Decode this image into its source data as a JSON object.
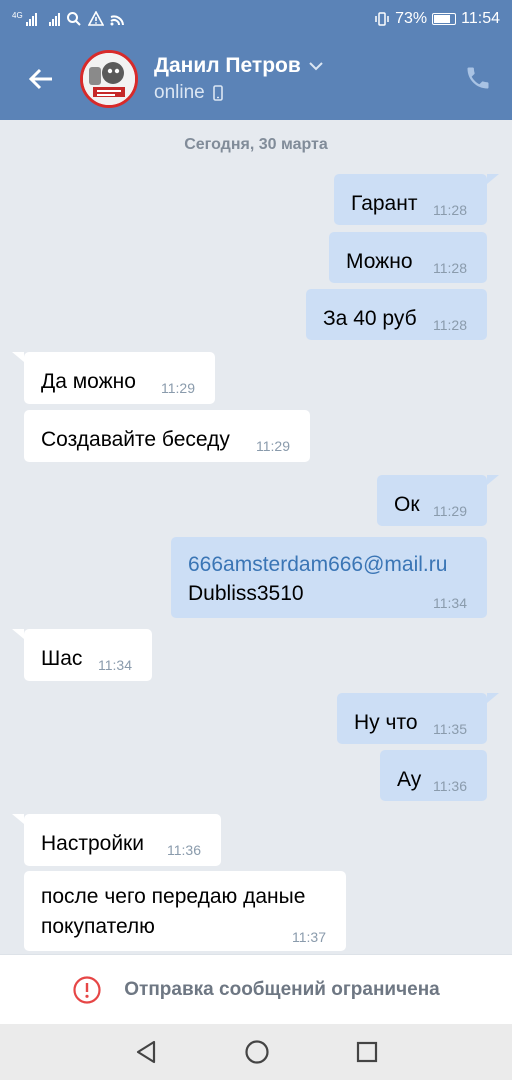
{
  "status_bar": {
    "network_label": "4G",
    "battery_percent": "73%",
    "time": "11:54",
    "icons": [
      "signal-icon",
      "signal-icon",
      "search-icon",
      "warning-icon",
      "wifi-icon",
      "vibrate-icon",
      "battery-icon"
    ]
  },
  "header": {
    "contact_name": "Данил Петров",
    "contact_status": "online",
    "icons": [
      "back-arrow-icon",
      "chevron-down-icon",
      "mobile-device-icon",
      "phone-icon"
    ]
  },
  "chat": {
    "date_separator": "Сегодня, 30 марта",
    "messages": [
      {
        "direction": "out",
        "text": "Гарант",
        "time": "11:28"
      },
      {
        "direction": "out",
        "text": "Можно",
        "time": "11:28"
      },
      {
        "direction": "out",
        "text": "За 40 руб",
        "time": "11:28"
      },
      {
        "direction": "in",
        "text": "Да можно",
        "time": "11:29"
      },
      {
        "direction": "in",
        "text": "Создавайте беседу",
        "time": "11:29"
      },
      {
        "direction": "out",
        "text": "Ок",
        "time": "11:29"
      },
      {
        "direction": "out",
        "text_link": "666amsterdam666@mail.ru",
        "text_line2": "Dubliss3510",
        "time": "11:34"
      },
      {
        "direction": "in",
        "text": "Шас",
        "time": "11:34"
      },
      {
        "direction": "out",
        "text": "Ну что",
        "time": "11:35"
      },
      {
        "direction": "out",
        "text": "Ау",
        "time": "11:36"
      },
      {
        "direction": "in",
        "text": "Настройки",
        "time": "11:36"
      },
      {
        "direction": "in",
        "text_line1": "после чего передаю даные",
        "text_line2": "покупателю",
        "time": "11:37"
      }
    ]
  },
  "footer": {
    "restriction_text": "Отправка сообщений ограничена",
    "icon": "alert-circle-icon"
  },
  "nav_bar": {
    "buttons": [
      "back-triangle-icon",
      "home-circle-icon",
      "recents-square-icon"
    ]
  },
  "colors": {
    "header_bg": "#5b83b7",
    "chat_bg": "#e6eaef",
    "outgoing_bubble": "#ccdef5",
    "incoming_bubble": "#ffffff",
    "link": "#3a75b5",
    "alert": "#e64646"
  }
}
